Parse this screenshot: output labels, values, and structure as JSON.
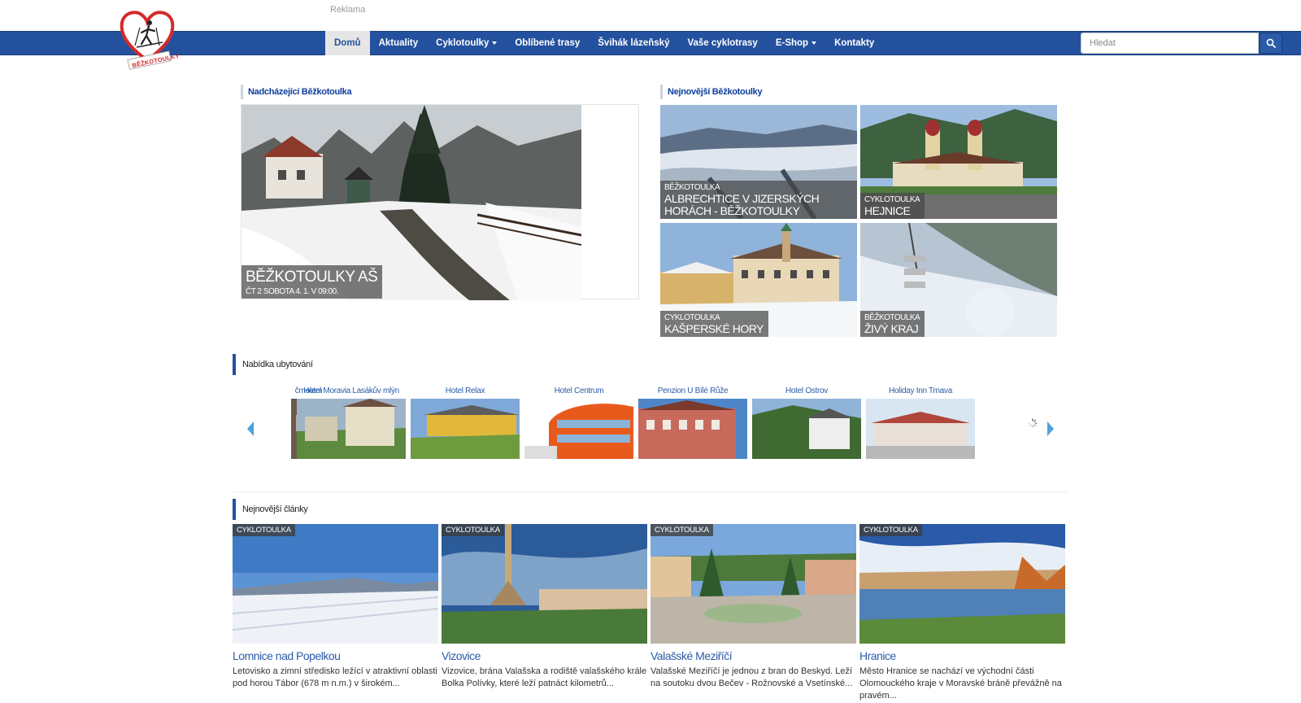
{
  "header": {
    "ad_label": "Reklama",
    "logo_text": "BĚŽKOTOULKY",
    "nav": [
      {
        "label": "Domů",
        "active": true,
        "dropdown": false
      },
      {
        "label": "Aktuality",
        "active": false,
        "dropdown": false
      },
      {
        "label": "Cyklotoulky",
        "active": false,
        "dropdown": true
      },
      {
        "label": "Oblíbené trasy",
        "active": false,
        "dropdown": false
      },
      {
        "label": "Švihák lázeňský",
        "active": false,
        "dropdown": false
      },
      {
        "label": "Vaše cyklotrasy",
        "active": false,
        "dropdown": false
      },
      {
        "label": "E-Shop",
        "active": false,
        "dropdown": true
      },
      {
        "label": "Kontakty",
        "active": false,
        "dropdown": false
      }
    ],
    "search": {
      "placeholder": "Hledat",
      "icon": "search-icon"
    }
  },
  "upcoming": {
    "heading": "Nadcházející Běžkotoulka",
    "title": "BĚŽKOTOULKY AŠ",
    "date": "ČT 2 SOBOTA 4. 1. V 09:00."
  },
  "newest": {
    "heading": "Nejnovější Běžkotoulky",
    "tiles": [
      {
        "category": "BĚŽKOTOULKA",
        "title": "ALBRECHTICE V JIZERSKÝCH HORÁCH - BĚŽKOTOULKY"
      },
      {
        "category": "CYKLOTOULKA",
        "title": "HEJNICE"
      },
      {
        "category": "CYKLOTOULKA",
        "title": "KAŠPERSKÉ HORY"
      },
      {
        "category": "BĚŽKOTOULKA",
        "title": "ŽIVÝ KRAJ"
      }
    ]
  },
  "accommodation": {
    "heading": "Nabídka ubytování",
    "items": [
      {
        "name": "čmolem"
      },
      {
        "name": "Hotel Moravia Lasákův mlýn"
      },
      {
        "name": "Hotel Relax"
      },
      {
        "name": "Hotel Centrum"
      },
      {
        "name": "Penzion U Bílé Růže"
      },
      {
        "name": "Hotel Ostrov"
      },
      {
        "name": "Holiday Inn Trnava"
      }
    ]
  },
  "articles": {
    "heading": "Nejnovější články",
    "items": [
      {
        "badge": "CYKLOTOULKA",
        "title": "Lomnice nad Popelkou",
        "text": "Letovisko a zimní středisko ležící v atraktivní oblasti pod horou Tábor (678 m n.m.) v širokém..."
      },
      {
        "badge": "CYKLOTOULKA",
        "title": "Vizovice",
        "text": "Vizovice, brána Valašska a rodiště valašského krále Bolka Polívky, které leží patnáct kilometrů..."
      },
      {
        "badge": "CYKLOTOULKA",
        "title": "Valašské Meziříčí",
        "text": "Valašské Meziříčí je jednou z bran do Beskyd. Leží na soutoku dvou Bečev - Rožnovské a Vsetínské..."
      },
      {
        "badge": "CYKLOTOULKA",
        "title": "Hranice",
        "text": "Město Hranice se nachází ve východní části Olomouckého kraje v Moravské bráně převážně na pravém..."
      }
    ]
  }
}
